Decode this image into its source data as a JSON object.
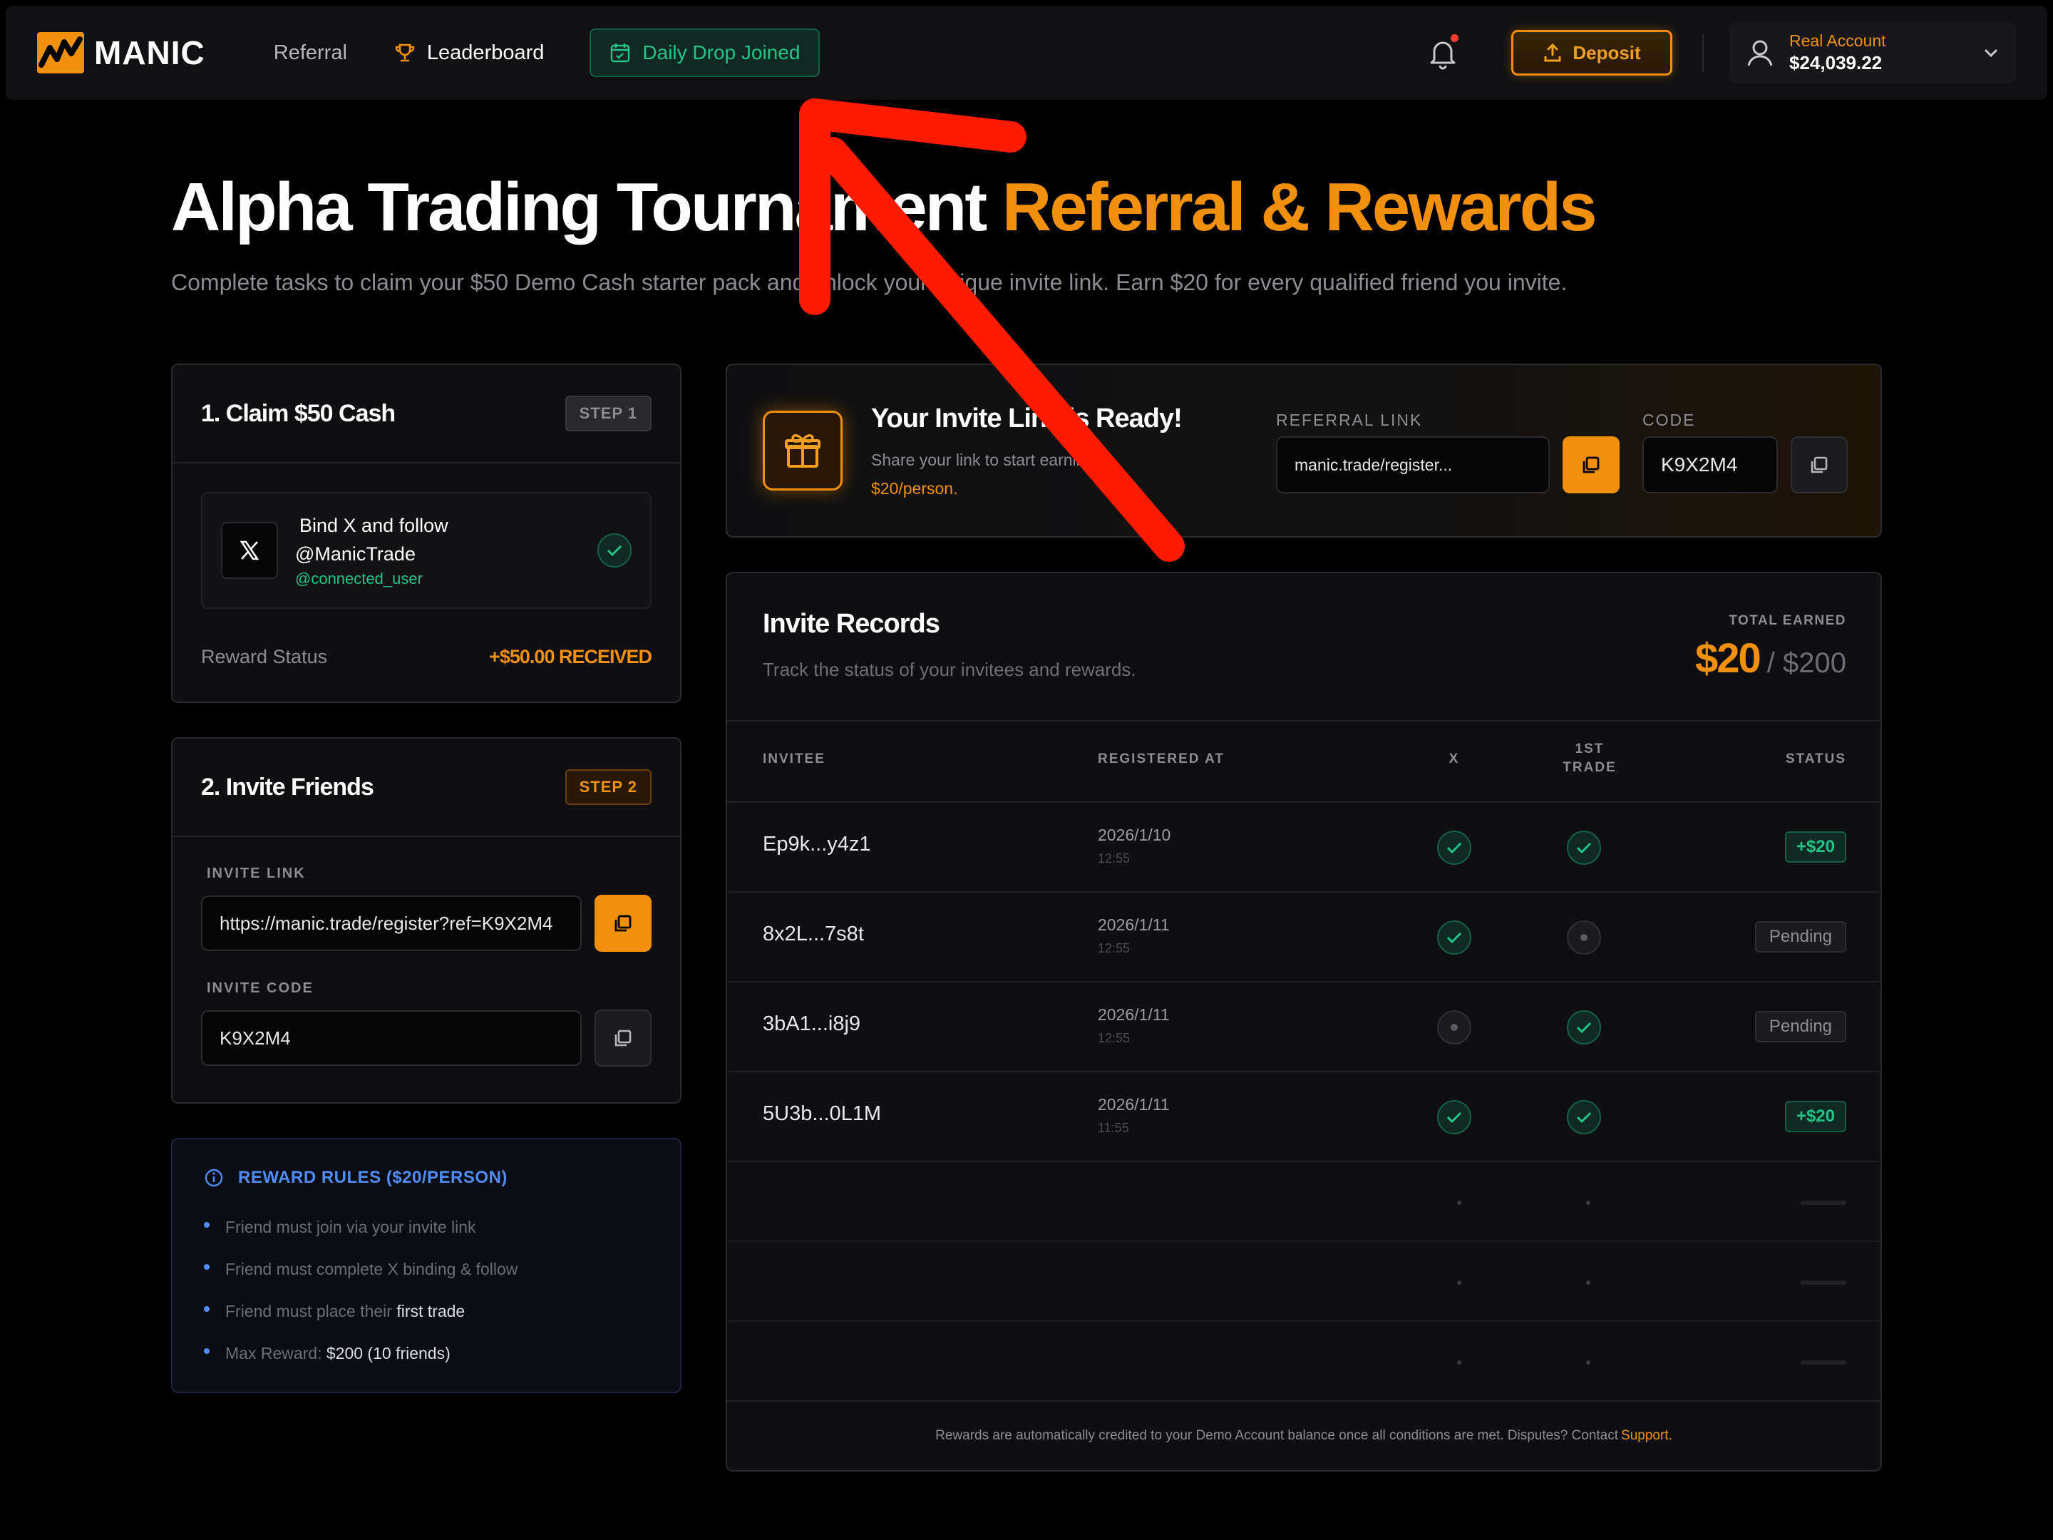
{
  "nav": {
    "brand": "MANIC",
    "links": {
      "referral": "Referral",
      "leaderboard": "Leaderboard"
    },
    "daily_drop": "Daily Drop Joined",
    "deposit": "Deposit",
    "account": {
      "type": "Real Account",
      "balance": "$24,039.22"
    }
  },
  "hero": {
    "title_white": "Alpha Trading Tournament ",
    "title_accent": "Referral & Rewards",
    "subtitle": "Complete tasks to claim your $50 Demo Cash starter pack and unlock your unique invite link. Earn $20 for every qualified friend you invite."
  },
  "claim": {
    "title": "1. Claim $50 Cash",
    "step": "STEP 1",
    "task_line1": "Bind X and follow",
    "task_line2": "@ManicTrade",
    "connected_user": "@connected_user",
    "reward_label": "Reward Status",
    "reward_value": "+$50.00 RECEIVED"
  },
  "invite": {
    "title": "2. Invite Friends",
    "step": "STEP 2",
    "link_label": "INVITE LINK",
    "link_value": "https://manic.trade/register?ref=K9X2M4",
    "code_label": "INVITE CODE",
    "code_value": "K9X2M4"
  },
  "rules": {
    "title": "REWARD RULES ($20/PERSON)",
    "items": [
      {
        "text": "Friend must join via your invite link",
        "hl": ""
      },
      {
        "text": "Friend must complete X binding & follow",
        "hl": ""
      },
      {
        "text": "Friend must place their ",
        "hl": "first trade"
      },
      {
        "text": "Max Reward: ",
        "hl": "$200 (10 friends)"
      }
    ]
  },
  "ready": {
    "title": "Your Invite Link is Ready!",
    "sub1": "Share your link to start earning",
    "sub2": "$20/person.",
    "ref_label": "REFERRAL LINK",
    "ref_value": "manic.trade/register...",
    "code_label": "CODE",
    "code_value": "K9X2M4"
  },
  "records": {
    "title": "Invite Records",
    "subtitle": "Track the status of your invitees and rewards.",
    "total_label": "TOTAL EARNED",
    "total_value": "$20",
    "total_max": "/ $200",
    "headers": {
      "invitee": "INVITEE",
      "registered": "REGISTERED AT",
      "x": "X",
      "trade_l1": "1ST",
      "trade_l2": "TRADE",
      "status": "STATUS"
    },
    "rows": [
      {
        "invitee": "Ep9k...y4z1",
        "date": "2026/1/10",
        "time": "12:55",
        "x": true,
        "trade": true,
        "status": "+$20",
        "earned": true
      },
      {
        "invitee": "8x2L...7s8t",
        "date": "2026/1/11",
        "time": "12:55",
        "x": true,
        "trade": false,
        "status": "Pending",
        "earned": false
      },
      {
        "invitee": "3bA1...i8j9",
        "date": "2026/1/11",
        "time": "12:55",
        "x": false,
        "trade": true,
        "status": "Pending",
        "earned": false
      },
      {
        "invitee": "5U3b...0L1M",
        "date": "2026/1/11",
        "time": "11:55",
        "x": true,
        "trade": true,
        "status": "+$20",
        "earned": true
      }
    ],
    "footer_text": "Rewards are automatically credited to your Demo Account balance once all conditions are met. Disputes? Contact",
    "footer_link": "Support."
  },
  "colors": {
    "accent": "#f0900c",
    "success": "#22c588",
    "info": "#4f8cf5",
    "annotation": "#ff1a00"
  }
}
